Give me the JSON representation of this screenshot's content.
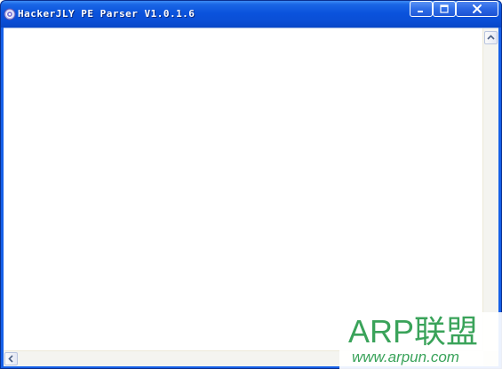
{
  "window": {
    "title": "HackerJLY PE Parser V1.0.1.6",
    "icon": "gear-app-icon",
    "controls": {
      "minimize_icon": "minimize-icon",
      "maximize_icon": "maximize-icon",
      "close_icon": "close-icon"
    }
  },
  "content": {
    "text": ""
  },
  "scrollbars": {
    "vertical_up_icon": "arrow-up-icon",
    "horizontal_left_icon": "arrow-left-icon"
  },
  "watermark": {
    "main": "ARP联盟",
    "sub": "www.arpun.com"
  },
  "colors": {
    "titlebar": "#0a4fd6",
    "watermark": "#3aa35a",
    "client_bg": "#ffffff"
  }
}
